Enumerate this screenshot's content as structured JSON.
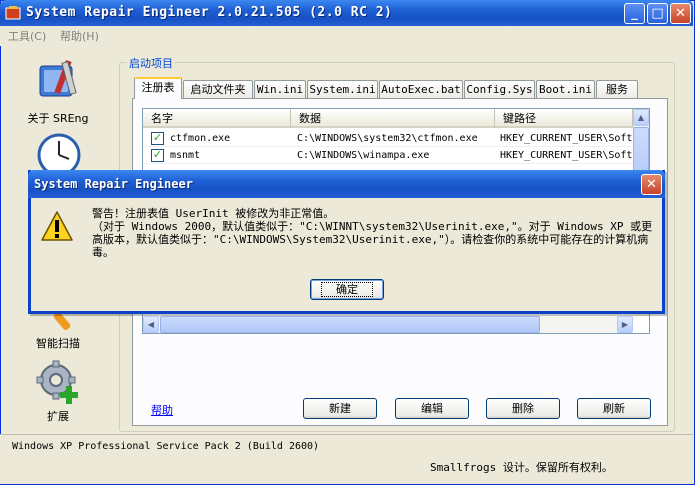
{
  "window": {
    "title": "System Repair Engineer 2.0.21.505 (2.0 RC 2)",
    "menu": [
      "工具(C)",
      "帮助(H)"
    ],
    "controls": [
      "minimize-icon",
      "maximize-icon",
      "close-icon"
    ]
  },
  "sidebar": {
    "items": [
      {
        "label": "关于 SREng",
        "icon": "toolbox-icon"
      },
      {
        "label": "",
        "icon": "clock-icon"
      },
      {
        "label": "智能扫描",
        "icon": "magnifier-icon"
      },
      {
        "label": "扩展",
        "icon": "gear-plus-icon"
      }
    ]
  },
  "group": {
    "legend": "启动项目",
    "tabs": [
      "注册表",
      "启动文件夹",
      "Win.ini",
      "System.ini",
      "AutoExec.bat",
      "Config.Sys",
      "Boot.ini",
      "服务"
    ],
    "selected_tab": "注册表"
  },
  "list": {
    "columns": [
      "名字",
      "数据",
      "键路径"
    ],
    "rows": [
      {
        "checked": true,
        "name": "ctfmon.exe",
        "data": "C:\\WINDOWS\\system32\\ctfmon.exe",
        "path": "HKEY_CURRENT_USER\\Soft"
      },
      {
        "checked": true,
        "name": "msnmt",
        "data": "C:\\WINDOWS\\winampa.exe",
        "path": "HKEY_CURRENT_USER\\Soft"
      }
    ]
  },
  "help_link": "帮助",
  "buttons": {
    "new": "新建",
    "edit": "编辑",
    "delete": "删除",
    "refresh": "刷新"
  },
  "status": {
    "os": "Windows XP Professional Service Pack 2 (Build 2600)",
    "copyright": "Smallfrogs 设计。保留所有权利。"
  },
  "dialog": {
    "title": "System Repair Engineer",
    "message_line1": "警告！注册表值 UserInit 被修改为非正常值。",
    "message_line2": "（对于 Windows 2000，默认值类似于：\"C:\\WINNT\\system32\\Userinit.exe,\"。对于 Windows XP 或更高版本，默认值类似于：\"C:\\WINDOWS\\System32\\Userinit.exe,\"）。请检查你的系统中可能存在的计算机病毒。",
    "ok": "确定",
    "icon": "warning-icon"
  }
}
